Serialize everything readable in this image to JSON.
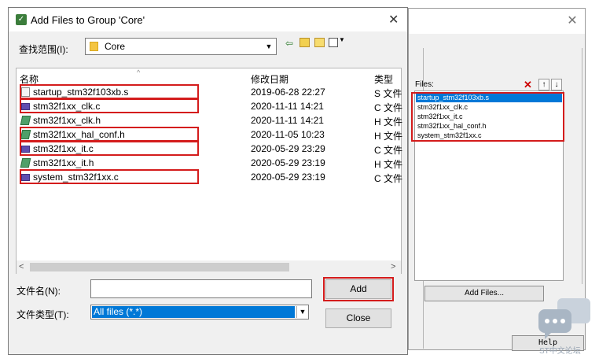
{
  "dialog": {
    "title": "Add Files to Group 'Core'",
    "close_icon": "close-icon",
    "lookin": {
      "label": "查找范围(I):",
      "value": "Core"
    },
    "columns": {
      "name": "名称",
      "date": "修改日期",
      "type": "类型"
    },
    "files": [
      {
        "name": "startup_stm32f103xb.s",
        "date": "2019-06-28 22:27",
        "type": "S 文件",
        "icon": "asm-file-icon"
      },
      {
        "name": "stm32f1xx_clk.c",
        "date": "2020-11-11 14:21",
        "type": "C 文件",
        "icon": "c-file-icon"
      },
      {
        "name": "stm32f1xx_clk.h",
        "date": "2020-11-11 14:21",
        "type": "H 文件",
        "icon": "h-file-icon"
      },
      {
        "name": "stm32f1xx_hal_conf.h",
        "date": "2020-11-05 10:23",
        "type": "H 文件",
        "icon": "h-file-icon"
      },
      {
        "name": "stm32f1xx_it.c",
        "date": "2020-05-29 23:29",
        "type": "C 文件",
        "icon": "c-file-icon"
      },
      {
        "name": "stm32f1xx_it.h",
        "date": "2020-05-29 23:19",
        "type": "H 文件",
        "icon": "h-file-icon"
      },
      {
        "name": "system_stm32f1xx.c",
        "date": "2020-05-29 23:19",
        "type": "C 文件",
        "icon": "c-file-icon"
      }
    ],
    "filename": {
      "label": "文件名(N):",
      "value": ""
    },
    "filetype": {
      "label": "文件类型(T):",
      "value": "All files (*.*)"
    },
    "add_label": "Add",
    "close_label": "Close"
  },
  "manage": {
    "files_label": "Files:",
    "list": [
      "startup_stm32f103xb.s",
      "stm32f1xx_clk.c",
      "stm32f1xx_it.c",
      "stm32f1xx_hal_conf.h",
      "system_stm32f1xx.c"
    ],
    "add_files_label": "Add Files...",
    "help_label": "Help"
  },
  "watermark": {
    "text": "ST中文论坛"
  },
  "colors": {
    "highlight": "#d41c1c",
    "selection": "#0078d7"
  }
}
